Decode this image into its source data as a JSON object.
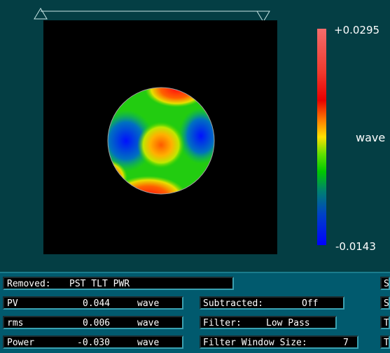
{
  "colorbar": {
    "max_label": "+0.0295",
    "min_label": "-0.0143",
    "unit": "wave"
  },
  "removed": {
    "label": "Removed:",
    "value": "PST TLT PWR"
  },
  "stats": [
    {
      "label": "PV",
      "value": "0.044",
      "unit": "wave"
    },
    {
      "label": "rms",
      "value": "0.006",
      "unit": "wave"
    },
    {
      "label": "Power",
      "value": "-0.030",
      "unit": "wave"
    }
  ],
  "subtracted": {
    "label": "Subtracted:",
    "value": "Off"
  },
  "filter": {
    "label": "Filter:",
    "value": "Low Pass"
  },
  "filter_window": {
    "label": "Filter Window Size:",
    "value": "7"
  },
  "right_edge_labels": [
    "S",
    "S",
    "T",
    "T"
  ]
}
